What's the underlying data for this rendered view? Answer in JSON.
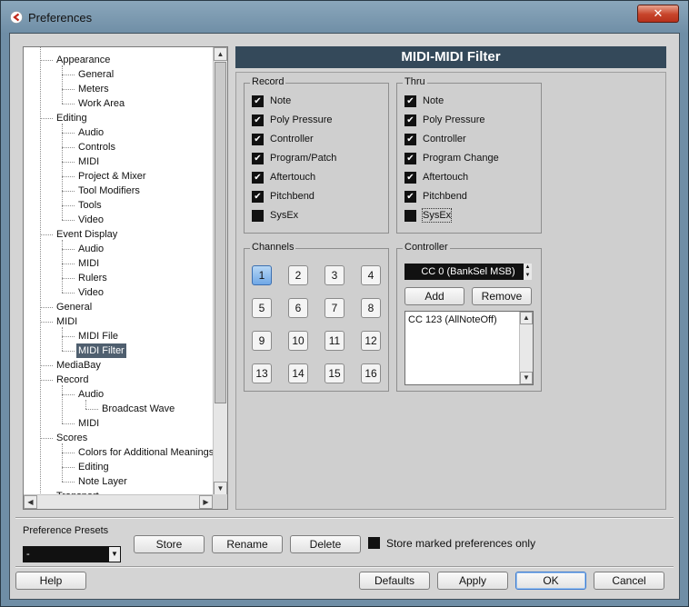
{
  "window": {
    "title": "Preferences",
    "close_glyph": "✕"
  },
  "tree": {
    "items": [
      {
        "label": "Appearance",
        "level": 1
      },
      {
        "label": "General",
        "level": 2
      },
      {
        "label": "Meters",
        "level": 2
      },
      {
        "label": "Work Area",
        "level": 2
      },
      {
        "label": "Editing",
        "level": 1
      },
      {
        "label": "Audio",
        "level": 2
      },
      {
        "label": "Controls",
        "level": 2
      },
      {
        "label": "MIDI",
        "level": 2
      },
      {
        "label": "Project & Mixer",
        "level": 2
      },
      {
        "label": "Tool Modifiers",
        "level": 2
      },
      {
        "label": "Tools",
        "level": 2
      },
      {
        "label": "Video",
        "level": 2
      },
      {
        "label": "Event Display",
        "level": 1
      },
      {
        "label": "Audio",
        "level": 2
      },
      {
        "label": "MIDI",
        "level": 2
      },
      {
        "label": "Rulers",
        "level": 2
      },
      {
        "label": "Video",
        "level": 2
      },
      {
        "label": "General",
        "level": 1
      },
      {
        "label": "MIDI",
        "level": 1
      },
      {
        "label": "MIDI File",
        "level": 2
      },
      {
        "label": "MIDI Filter",
        "level": 2,
        "selected": true
      },
      {
        "label": "MediaBay",
        "level": 1
      },
      {
        "label": "Record",
        "level": 1
      },
      {
        "label": "Audio",
        "level": 2
      },
      {
        "label": "Broadcast Wave",
        "level": 3
      },
      {
        "label": "MIDI",
        "level": 2
      },
      {
        "label": "Scores",
        "level": 1
      },
      {
        "label": "Colors for Additional Meanings",
        "level": 2
      },
      {
        "label": "Editing",
        "level": 2
      },
      {
        "label": "Note Layer",
        "level": 2
      },
      {
        "label": "Transport",
        "level": 1
      }
    ]
  },
  "panel": {
    "title": "MIDI-MIDI Filter",
    "record": {
      "label": "Record",
      "items": [
        {
          "label": "Note",
          "checked": true
        },
        {
          "label": "Poly Pressure",
          "checked": true
        },
        {
          "label": "Controller",
          "checked": true
        },
        {
          "label": "Program/Patch",
          "checked": true
        },
        {
          "label": "Aftertouch",
          "checked": true
        },
        {
          "label": "Pitchbend",
          "checked": true
        },
        {
          "label": "SysEx",
          "checked": false
        }
      ]
    },
    "thru": {
      "label": "Thru",
      "items": [
        {
          "label": "Note",
          "checked": true
        },
        {
          "label": "Poly Pressure",
          "checked": true
        },
        {
          "label": "Controller",
          "checked": true
        },
        {
          "label": "Program Change",
          "checked": true
        },
        {
          "label": "Aftertouch",
          "checked": true
        },
        {
          "label": "Pitchbend",
          "checked": true
        },
        {
          "label": "SysEx",
          "checked": false
        }
      ]
    },
    "channels": {
      "label": "Channels",
      "buttons": [
        "1",
        "2",
        "3",
        "4",
        "5",
        "6",
        "7",
        "8",
        "9",
        "10",
        "11",
        "12",
        "13",
        "14",
        "15",
        "16"
      ],
      "active": "1"
    },
    "controller": {
      "label": "Controller",
      "selected": "CC 0  (BankSel MSB)",
      "add_label": "Add",
      "remove_label": "Remove",
      "list": [
        "CC 123  (AllNoteOff)"
      ]
    }
  },
  "presets": {
    "label": "Preference Presets",
    "selected": "-",
    "store_label": "Store",
    "rename_label": "Rename",
    "delete_label": "Delete",
    "store_marked_label": "Store marked preferences only",
    "store_marked_checked": false
  },
  "footer": {
    "help_label": "Help",
    "defaults_label": "Defaults",
    "apply_label": "Apply",
    "ok_label": "OK",
    "cancel_label": "Cancel"
  },
  "colors": {
    "title_bar_bg": "#34495a",
    "selected_tree_bg": "#4f5f6f",
    "active_channel": "#6fa7e6",
    "close_button": "#c7432a"
  }
}
